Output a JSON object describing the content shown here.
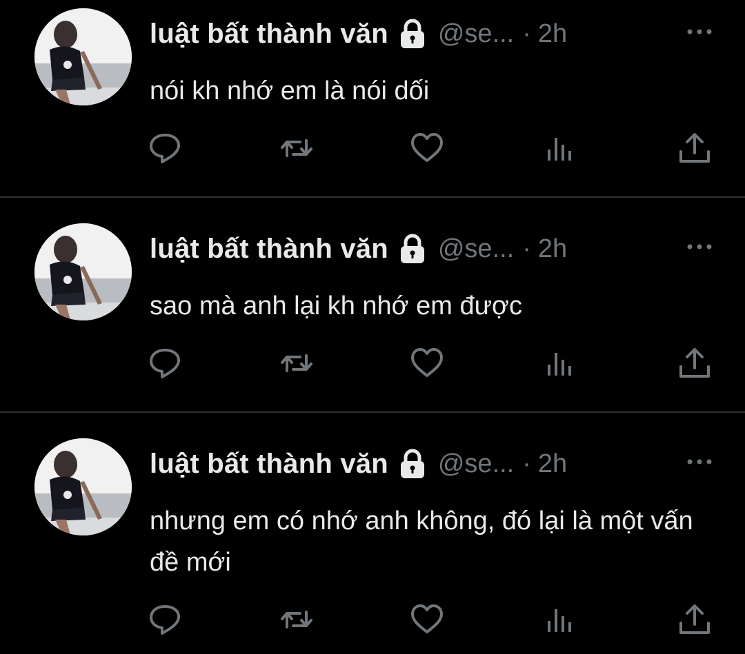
{
  "colors": {
    "background": "#000000",
    "primary_text": "#e7e9ea",
    "secondary_text": "#71767b",
    "divider": "#2f3336"
  },
  "tweets": [
    {
      "author_name": "luật bất thành văn",
      "handle": "@se...",
      "separator": "·",
      "time": "2h",
      "protected_icon": "lock-icon",
      "text": "nói kh nhớ em là nói dối"
    },
    {
      "author_name": "luật bất thành văn",
      "handle": "@se...",
      "separator": "·",
      "time": "2h",
      "protected_icon": "lock-icon",
      "text": "sao mà anh lại kh nhớ em được"
    },
    {
      "author_name": "luật bất thành văn",
      "handle": "@se...",
      "separator": "·",
      "time": "2h",
      "protected_icon": "lock-icon",
      "text": "nhưng em có nhớ anh không, đó lại là một vấn đề mới"
    }
  ],
  "action_icons": [
    "reply-icon",
    "retweet-icon",
    "like-icon",
    "views-icon",
    "share-icon"
  ]
}
